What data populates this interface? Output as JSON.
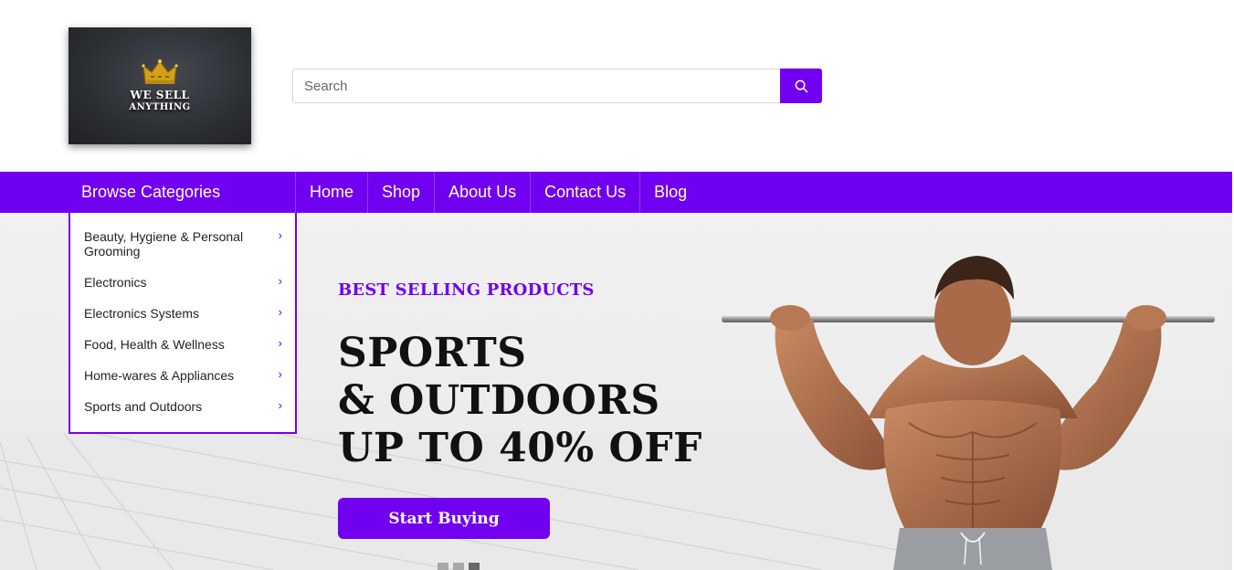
{
  "logo": {
    "line1": "WE SELL",
    "line2": "ANYTHING",
    "icon": "crown-icon"
  },
  "search": {
    "placeholder": "Search",
    "value": "",
    "button_icon": "search-icon"
  },
  "nav": {
    "browse_label": "Browse Categories",
    "items": [
      "Home",
      "Shop",
      "About Us",
      "Contact Us",
      "Blog"
    ]
  },
  "categories": [
    "Beauty, Hygiene & Personal Grooming",
    "Electronics",
    "Electronics Systems",
    "Food, Health & Wellness",
    "Home-wares & Appliances",
    "Sports and Outdoors"
  ],
  "hero": {
    "eyebrow": "BEST SELLING PRODUCTS",
    "line1": "SPORTS",
    "line2": "& OUTDOORS",
    "line3": "UP TO 40% OFF",
    "cta": "Start Buying",
    "slides": 3,
    "active_slide": 3
  },
  "colors": {
    "accent": "#7100f0",
    "text": "#111111"
  }
}
